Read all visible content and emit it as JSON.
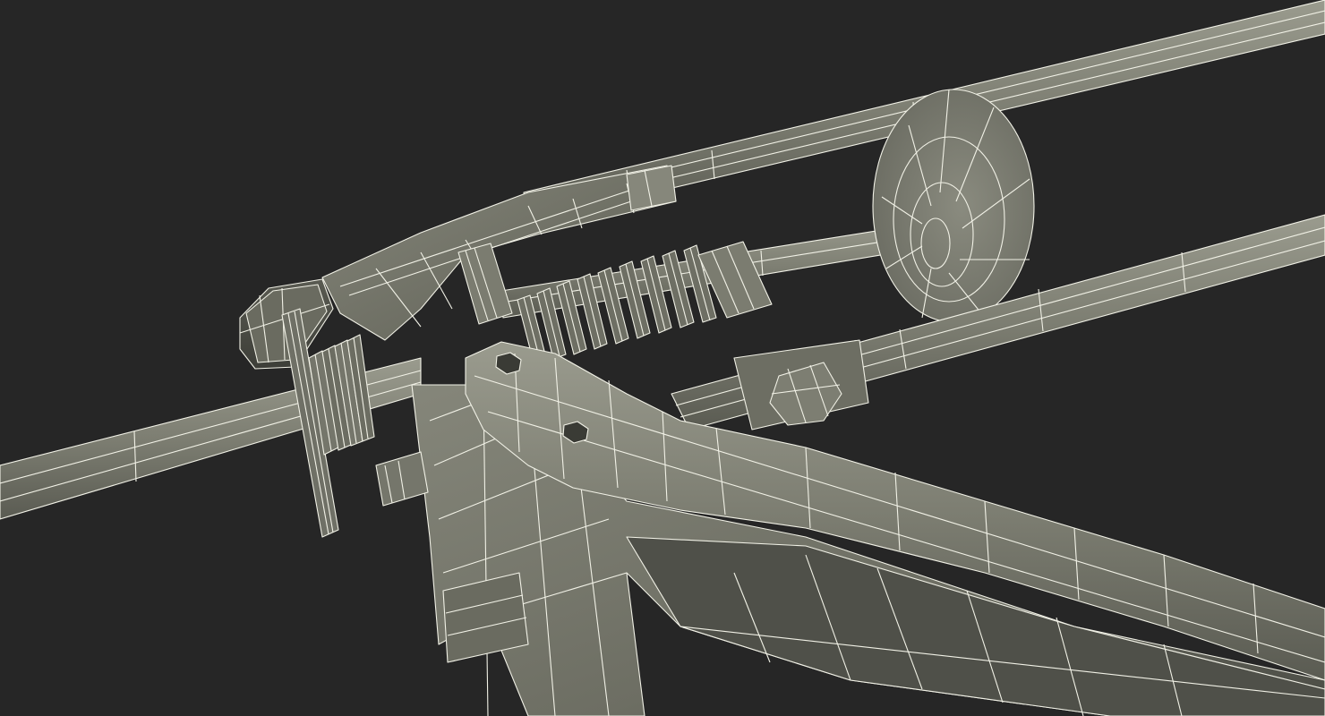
{
  "scene": {
    "subject": "caulking-gun-wireframe",
    "colors": {
      "background": "#262626",
      "surface": "#7d7e72",
      "surface_light": "#8f9083",
      "surface_dark": "#5f6057",
      "shadow": "#3a3b35",
      "wire": "#f1f1e6"
    }
  }
}
